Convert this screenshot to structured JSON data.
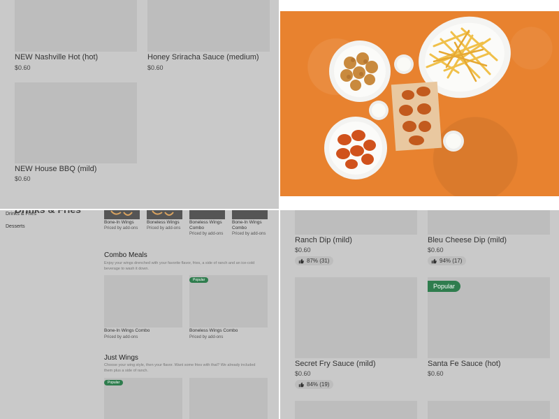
{
  "top_left": {
    "items": [
      {
        "name": "NEW Nashville Hot (hot)",
        "price": "$0.60"
      },
      {
        "name": "Honey Sriracha Sauce (medium)",
        "price": "$0.60"
      },
      {
        "name": "NEW House BBQ (mild)",
        "price": "$0.60"
      }
    ]
  },
  "bottom_left": {
    "cut_heading": "Drinks & Fries",
    "sidebar": [
      "Drinks & Fries",
      "Desserts"
    ],
    "top_row": [
      {
        "name": "Bone-In Wings",
        "price": "Priced by add-ons"
      },
      {
        "name": "Boneless Wings",
        "price": "Priced by add-ons"
      },
      {
        "name": "Boneless Wings Combo",
        "price": "Priced by add-ons"
      },
      {
        "name": "Bone-In Wings Combo",
        "price": "Priced by add-ons"
      }
    ],
    "combo": {
      "title": "Combo Meals",
      "desc": "Enjoy your wings drenched with your favorite flavor, fries, a side of ranch and an ice-cold beverage to wash it down.",
      "items": [
        {
          "name": "Bone-In Wings Combo",
          "price": "Priced by add-ons"
        },
        {
          "name": "Boneless Wings Combo",
          "price": "Priced by add-ons",
          "badge": "Popular"
        }
      ]
    },
    "just_wings": {
      "title": "Just Wings",
      "desc": "Choose your wing style, then your flavor. Want some fries with that? We already included them plus a side of ranch.",
      "badge": "Popular"
    }
  },
  "bottom_right": {
    "items": [
      {
        "name": "Ranch Dip (mild)",
        "price": "$0.60",
        "rating": "87% (31)"
      },
      {
        "name": "Bleu Cheese Dip (mild)",
        "price": "$0.60",
        "rating": "94% (17)"
      },
      {
        "name": "Secret Fry Sauce (mild)",
        "price": "$0.60",
        "rating": "84% (19)"
      },
      {
        "name": "Santa Fe Sauce (hot)",
        "price": "$0.60",
        "badge": "Popular"
      }
    ]
  },
  "icons": {
    "rating": "thumbs-up-icon"
  },
  "colors": {
    "overlay_gray": "#c9c9c9",
    "placeholder": "#bdbdbd",
    "popular_badge": "#2f7d4e",
    "food_background": "#e8822f"
  }
}
